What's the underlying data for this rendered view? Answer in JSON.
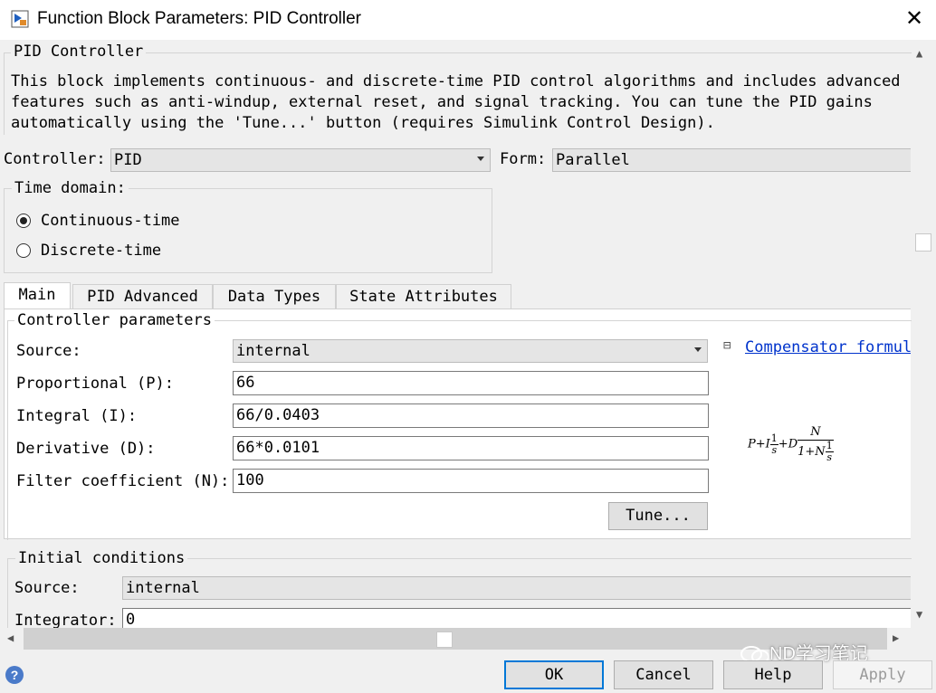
{
  "window": {
    "title": "Function Block Parameters: PID Controller",
    "icon": "simulink-block-icon",
    "close_glyph": "✕"
  },
  "description": {
    "legend": "PID Controller",
    "text": "This block implements continuous- and discrete-time PID control algorithms and includes advanced\nfeatures such as anti-windup, external reset, and signal tracking. You can tune the PID gains\nautomatically using the 'Tune...' button (requires Simulink Control Design)."
  },
  "controller": {
    "label": "Controller:",
    "value": "PID"
  },
  "form": {
    "label": "Form:",
    "value": "Parallel"
  },
  "time_domain": {
    "legend": "Time domain:",
    "options": [
      {
        "label": "Continuous-time",
        "selected": true
      },
      {
        "label": "Discrete-time",
        "selected": false
      }
    ]
  },
  "tabs": [
    {
      "label": "Main",
      "active": true
    },
    {
      "label": "PID Advanced",
      "active": false
    },
    {
      "label": "Data Types",
      "active": false
    },
    {
      "label": "State Attributes",
      "active": false
    }
  ],
  "controller_parameters": {
    "legend": "Controller parameters",
    "source_label": "Source:",
    "source_value": "internal",
    "proportional_label": "Proportional (P):",
    "proportional_value": "66",
    "integral_label": "Integral (I):",
    "integral_value": "66/0.0403",
    "derivative_label": "Derivative (D):",
    "derivative_value": "66*0.0101",
    "filter_label": "Filter coefficient (N):",
    "filter_value": "100",
    "tune_button": "Tune...",
    "compensator_toggle": "⊟",
    "compensator_link": "Compensator formula"
  },
  "formula": {
    "p": "P",
    "plus1": "+",
    "i": "I",
    "one": "1",
    "s": "s",
    "plus2": "+",
    "d": "D",
    "n_num": "N",
    "den_prefix": "1+N",
    "den_one": "1",
    "den_s": "s"
  },
  "initial_conditions": {
    "legend": "Initial conditions",
    "source_label": "Source:",
    "source_value": "internal",
    "integrator_label": "Integrator:",
    "integrator_value": "0"
  },
  "footer": {
    "help_icon": "?",
    "ok": "OK",
    "cancel": "Cancel",
    "help": "Help",
    "apply": "Apply",
    "watermark": "ND学习笔记"
  },
  "colors": {
    "link": "#0033cc",
    "default_button_border": "#0078d7"
  }
}
